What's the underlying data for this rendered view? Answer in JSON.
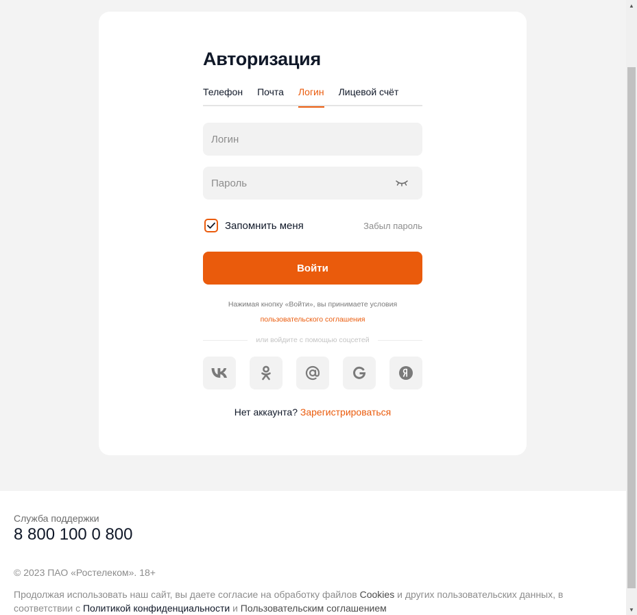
{
  "auth": {
    "title": "Авторизация",
    "tabs": [
      {
        "label": "Телефон",
        "active": false
      },
      {
        "label": "Почта",
        "active": false
      },
      {
        "label": "Логин",
        "active": true
      },
      {
        "label": "Лицевой счёт",
        "active": false
      }
    ],
    "login_placeholder": "Логин",
    "password_placeholder": "Пароль",
    "remember_label": "Запомнить меня",
    "remember_checked": true,
    "forgot_label": "Забыл пароль",
    "submit_label": "Войти",
    "terms_text": "Нажимая кнопку «Войти», вы принимаете условия",
    "terms_link": "пользовательского соглашения",
    "social_divider": "или войдите с помощью соцсетей",
    "socials": [
      "vk-icon",
      "ok-icon",
      "mail-icon",
      "google-icon",
      "yandex-icon"
    ],
    "no_account": "Нет аккаунта?",
    "register_link": "Зарегистрироваться"
  },
  "footer": {
    "support_label": "Служба поддержки",
    "support_phone": "8 800 100 0 800",
    "copyright": "© 2023 ПАО «Ростелеком». 18+",
    "consent_part1": "Продолжая использовать наш сайт, вы даете согласие на обработку файлов",
    "consent_cookies": "Cookies",
    "consent_part2": "и других пользовательских данных, в соответствии с",
    "consent_privacy": "Политикой конфиденциальности",
    "consent_and": "и",
    "consent_agreement": "Пользовательским соглашением"
  },
  "colors": {
    "accent": "#ea5b0c",
    "background": "#f3f3f3",
    "field": "#f2f2f2",
    "text": "#101828"
  }
}
